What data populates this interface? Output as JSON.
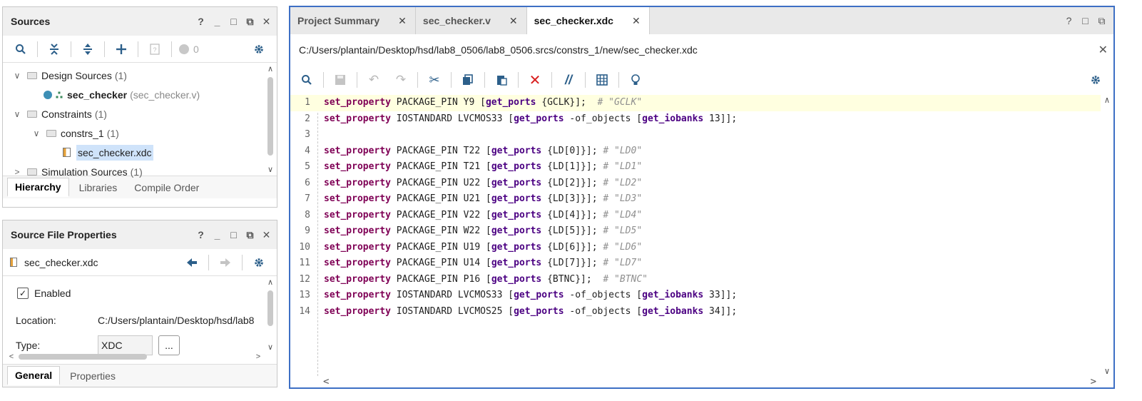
{
  "sources": {
    "title": "Sources",
    "window_controls": [
      "?",
      "_",
      "□",
      "⧉",
      "✕"
    ],
    "badge_count": "0",
    "tree": {
      "design_sources": {
        "label": "Design Sources",
        "count": "(1)"
      },
      "sec_checker": {
        "label": "sec_checker",
        "file": "(sec_checker.v)"
      },
      "constraints": {
        "label": "Constraints",
        "count": "(1)"
      },
      "constrs_1": {
        "label": "constrs_1",
        "count": "(1)"
      },
      "xdc_file": {
        "label": "sec_checker.xdc"
      },
      "simulation_sources": {
        "label": "Simulation Sources",
        "count": "(1)"
      }
    },
    "tabs": [
      "Hierarchy",
      "Libraries",
      "Compile Order"
    ]
  },
  "props": {
    "title": "Source File Properties",
    "file_name": "sec_checker.xdc",
    "enabled_label": "Enabled",
    "location_label": "Location:",
    "location_value": "C:/Users/plantain/Desktop/hsd/lab8",
    "type_label": "Type:",
    "type_value": "XDC",
    "more_btn": "...",
    "tabs": [
      "General",
      "Properties"
    ]
  },
  "editor": {
    "tabs": [
      {
        "label": "Project Summary",
        "close": "✕"
      },
      {
        "label": "sec_checker.v",
        "close": "✕"
      },
      {
        "label": "sec_checker.xdc",
        "close": "✕"
      }
    ],
    "path": "C:/Users/plantain/Desktop/hsd/lab8_0506/lab8_0506.srcs/constrs_1/new/sec_checker.xdc",
    "line_numbers": [
      "1",
      "2",
      "3",
      "4",
      "5",
      "6",
      "7",
      "8",
      "9",
      "10",
      "11",
      "12",
      "13",
      "14"
    ],
    "code": {
      "set_property": "set_property",
      "get_ports": "get_ports",
      "get_iobanks": "get_iobanks",
      "l1": {
        "a": " PACKAGE_PIN Y9 [",
        "b": " {GCLK}];  ",
        "c": "# \"GCLK\""
      },
      "l2": {
        "a": " IOSTANDARD LVCMOS33 [",
        "b": " -of_objects [",
        "c": " 13]];"
      },
      "l4": {
        "a": " PACKAGE_PIN T22 [",
        "b": " {LD[0]}]; ",
        "c": "# \"LD0\""
      },
      "l5": {
        "a": " PACKAGE_PIN T21 [",
        "b": " {LD[1]}]; ",
        "c": "# \"LD1\""
      },
      "l6": {
        "a": " PACKAGE_PIN U22 [",
        "b": " {LD[2]}]; ",
        "c": "# \"LD2\""
      },
      "l7": {
        "a": " PACKAGE_PIN U21 [",
        "b": " {LD[3]}]; ",
        "c": "# \"LD3\""
      },
      "l8": {
        "a": " PACKAGE_PIN V22 [",
        "b": " {LD[4]}]; ",
        "c": "# \"LD4\""
      },
      "l9": {
        "a": " PACKAGE_PIN W22 [",
        "b": " {LD[5]}]; ",
        "c": "# \"LD5\""
      },
      "l10": {
        "a": " PACKAGE_PIN U19 [",
        "b": " {LD[6]}]; ",
        "c": "# \"LD6\""
      },
      "l11": {
        "a": " PACKAGE_PIN U14 [",
        "b": " {LD[7]}]; ",
        "c": "# \"LD7\""
      },
      "l12": {
        "a": " PACKAGE_PIN P16 [",
        "b": " {BTNC}];  ",
        "c": "# \"BTNC\""
      },
      "l13": {
        "a": " IOSTANDARD LVCMOS33 [",
        "b": " -of_objects [",
        "c": " 33]];"
      },
      "l14": {
        "a": " IOSTANDARD LVCMOS25 [",
        "b": " -of_objects [",
        "c": " 34]];"
      }
    }
  },
  "colors": {
    "accent": "#3d6fc4",
    "keyword": "#7f0055",
    "function": "#4b0082",
    "comment": "#8f8f8f",
    "current_line": "#ffffe0",
    "selection": "#cfe3fa",
    "delete": "#d81e1e"
  }
}
